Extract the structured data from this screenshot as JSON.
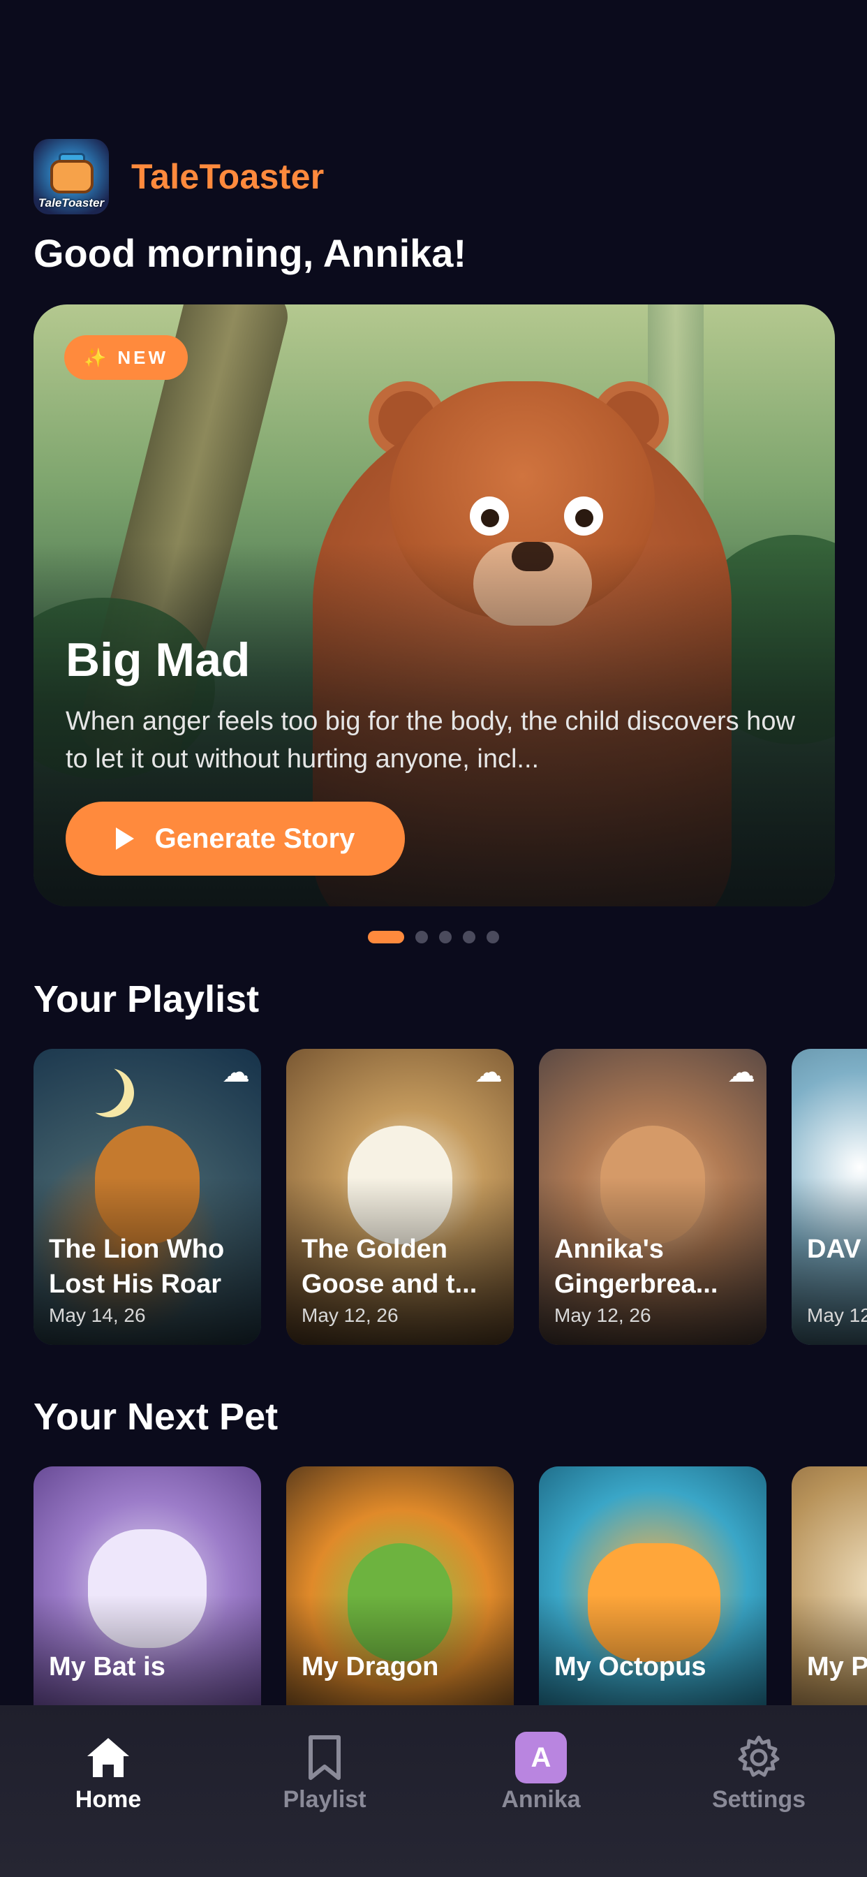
{
  "app": {
    "name": "TaleToaster",
    "logo_text": "TaleToaster"
  },
  "greeting": "Good morning, Annika!",
  "hero": {
    "badge": "NEW",
    "badge_icon": "sparkles-icon",
    "title": "Big Mad",
    "description": "When anger feels too big for the body, the child discovers how to let it out without hurting anyone, incl...",
    "cta_label": "Generate Story",
    "carousel_total": 5,
    "carousel_active": 1
  },
  "playlist": {
    "title": "Your Playlist",
    "items": [
      {
        "title": "The Lion Who Lost His Roar",
        "date": "May 14, 26",
        "icon": "cloud-icon"
      },
      {
        "title": "The Golden Goose and t...",
        "date": "May 12, 26",
        "icon": "cloud-icon"
      },
      {
        "title": "Annika's Gingerbrea...",
        "date": "May 12, 26",
        "icon": "cloud-icon"
      },
      {
        "title": "DAV THE",
        "date": "May 12",
        "icon": "cloud-icon"
      }
    ]
  },
  "pets": {
    "title": "Your Next Pet",
    "items": [
      {
        "title": "My Bat is"
      },
      {
        "title": "My Dragon"
      },
      {
        "title": "My Octopus"
      },
      {
        "title": "My P"
      }
    ]
  },
  "tabbar": {
    "items": [
      {
        "label": "Home",
        "icon": "home-icon",
        "active": true
      },
      {
        "label": "Playlist",
        "icon": "bookmark-icon",
        "active": false
      },
      {
        "label": "Annika",
        "icon": "avatar",
        "avatar_letter": "A",
        "active": false
      },
      {
        "label": "Settings",
        "icon": "gear-icon",
        "active": false
      }
    ]
  },
  "colors": {
    "background": "#0b0b1c",
    "accent": "#ff8a3d",
    "avatar": "#b985e0",
    "tab_inactive": "#8a8a98"
  }
}
